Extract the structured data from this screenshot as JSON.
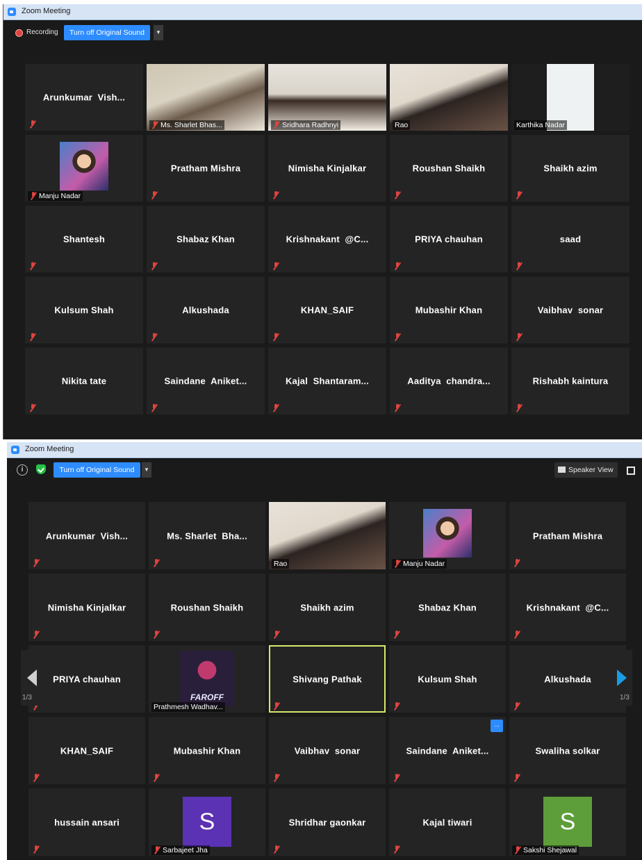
{
  "window1": {
    "title": "Zoom Meeting",
    "recording_label": "Recording",
    "original_sound_btn": "Turn off Original Sound",
    "tiles": [
      {
        "name": "Arunkumar  Vish...",
        "kind": "text"
      },
      {
        "name": "Ms. Sharlet Bhas...",
        "kind": "video"
      },
      {
        "name": "Sridhara Radhnyi",
        "kind": "video"
      },
      {
        "name": "Rao",
        "kind": "video"
      },
      {
        "name": "Karthika Nadar",
        "kind": "video",
        "active": true
      },
      {
        "name": "Manju Nadar",
        "kind": "avatar"
      },
      {
        "name": "Pratham Mishra",
        "kind": "text"
      },
      {
        "name": "Nimisha Kinjalkar",
        "kind": "text"
      },
      {
        "name": "Roushan Shaikh",
        "kind": "text"
      },
      {
        "name": "Shaikh azim",
        "kind": "text"
      },
      {
        "name": "Shantesh",
        "kind": "text"
      },
      {
        "name": "Shabaz Khan",
        "kind": "text"
      },
      {
        "name": "Krishnakant  @C...",
        "kind": "text"
      },
      {
        "name": "PRIYA chauhan",
        "kind": "text"
      },
      {
        "name": "saad",
        "kind": "text"
      },
      {
        "name": "Kulsum Shah",
        "kind": "text"
      },
      {
        "name": "Alkushada",
        "kind": "text"
      },
      {
        "name": "KHAN_SAIF",
        "kind": "text"
      },
      {
        "name": "Mubashir Khan",
        "kind": "text"
      },
      {
        "name": "Vaibhav  sonar",
        "kind": "text"
      },
      {
        "name": "Nikita tate",
        "kind": "text"
      },
      {
        "name": "Saindane  Aniket...",
        "kind": "text"
      },
      {
        "name": "Kajal  Shantaram...",
        "kind": "text"
      },
      {
        "name": "Aaditya  chandra...",
        "kind": "text"
      },
      {
        "name": "Rishabh kaintura",
        "kind": "text"
      }
    ]
  },
  "window2": {
    "title": "Zoom Meeting",
    "original_sound_btn": "Turn off Original Sound",
    "speaker_view_btn": "Speaker View",
    "page_left": "1/3",
    "page_right": "1/3",
    "tiles": [
      {
        "name": "Arunkumar  Vish...",
        "kind": "text"
      },
      {
        "name": "Ms. Sharlet  Bha...",
        "kind": "text"
      },
      {
        "name": "Rao",
        "kind": "video"
      },
      {
        "name": "Manju Nadar",
        "kind": "avatar"
      },
      {
        "name": "Pratham Mishra",
        "kind": "text"
      },
      {
        "name": "Nimisha Kinjalkar",
        "kind": "text"
      },
      {
        "name": "Roushan Shaikh",
        "kind": "text"
      },
      {
        "name": "Shaikh azim",
        "kind": "text"
      },
      {
        "name": "Shabaz Khan",
        "kind": "text"
      },
      {
        "name": "Krishnakant  @C...",
        "kind": "text"
      },
      {
        "name": "PRIYA chauhan",
        "kind": "text"
      },
      {
        "name": "Prathmesh Wadhav...",
        "kind": "logo",
        "logo_text": "FAROFF"
      },
      {
        "name": "Shivang Pathak",
        "kind": "text",
        "active": true
      },
      {
        "name": "Kulsum Shah",
        "kind": "text"
      },
      {
        "name": "Alkushada",
        "kind": "text"
      },
      {
        "name": "KHAN_SAIF",
        "kind": "text"
      },
      {
        "name": "Mubashir Khan",
        "kind": "text"
      },
      {
        "name": "Vaibhav  sonar",
        "kind": "text"
      },
      {
        "name": "Saindane  Aniket...",
        "kind": "text",
        "more": true
      },
      {
        "name": "Swaliha solkar",
        "kind": "text"
      },
      {
        "name": "hussain ansari",
        "kind": "text"
      },
      {
        "name": "Sarbajeet Jha",
        "kind": "letter",
        "letter": "S",
        "color": "#5b32b4"
      },
      {
        "name": "Shridhar gaonkar",
        "kind": "text"
      },
      {
        "name": "Kajal tiwari",
        "kind": "text"
      },
      {
        "name": "Sakshi Shejawal",
        "kind": "letter",
        "letter": "S",
        "color": "#5e9e3a"
      }
    ]
  },
  "more_icon": "...",
  "colors": {
    "accent": "#2d8cff",
    "active_border": "#d7e86a",
    "muted": "#e0443e"
  }
}
